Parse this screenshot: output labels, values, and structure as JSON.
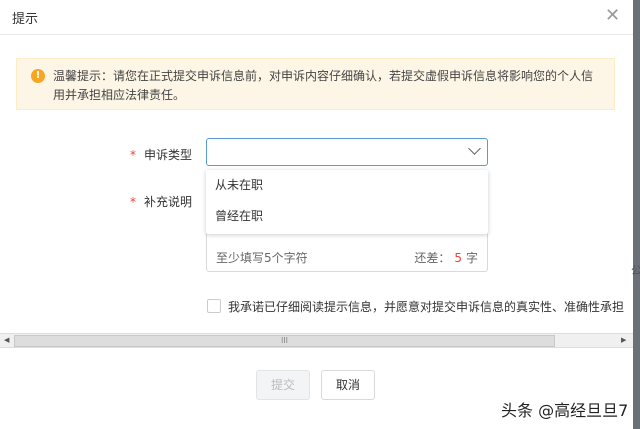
{
  "dialog": {
    "title": "提示",
    "close_icon": "close-icon"
  },
  "alert": {
    "text": "温馨提示：请您在正式提交申诉信息前，对申诉内容仔细确认，若提交虚假申诉信息将影响您的个人信用并承担相应法律责任。",
    "icon": "!"
  },
  "form": {
    "type_label": "申诉类型",
    "required_mark": "*",
    "type_value": "",
    "type_options": [
      "从未在职",
      "曾经在职"
    ],
    "note_label": "补充说明",
    "note_hint": "至少填写5个字符",
    "remaining_label": "还差：",
    "remaining_count": "5",
    "remaining_unit": "字",
    "agreement": "我承诺已仔细阅读提示信息，并愿意对提交申诉信息的真实性、准确性承担"
  },
  "scrollbar": {
    "grip": "III"
  },
  "buttons": {
    "submit": "提交",
    "cancel": "取消"
  },
  "watermark": "头条 @高经旦旦7",
  "side_text": "公"
}
